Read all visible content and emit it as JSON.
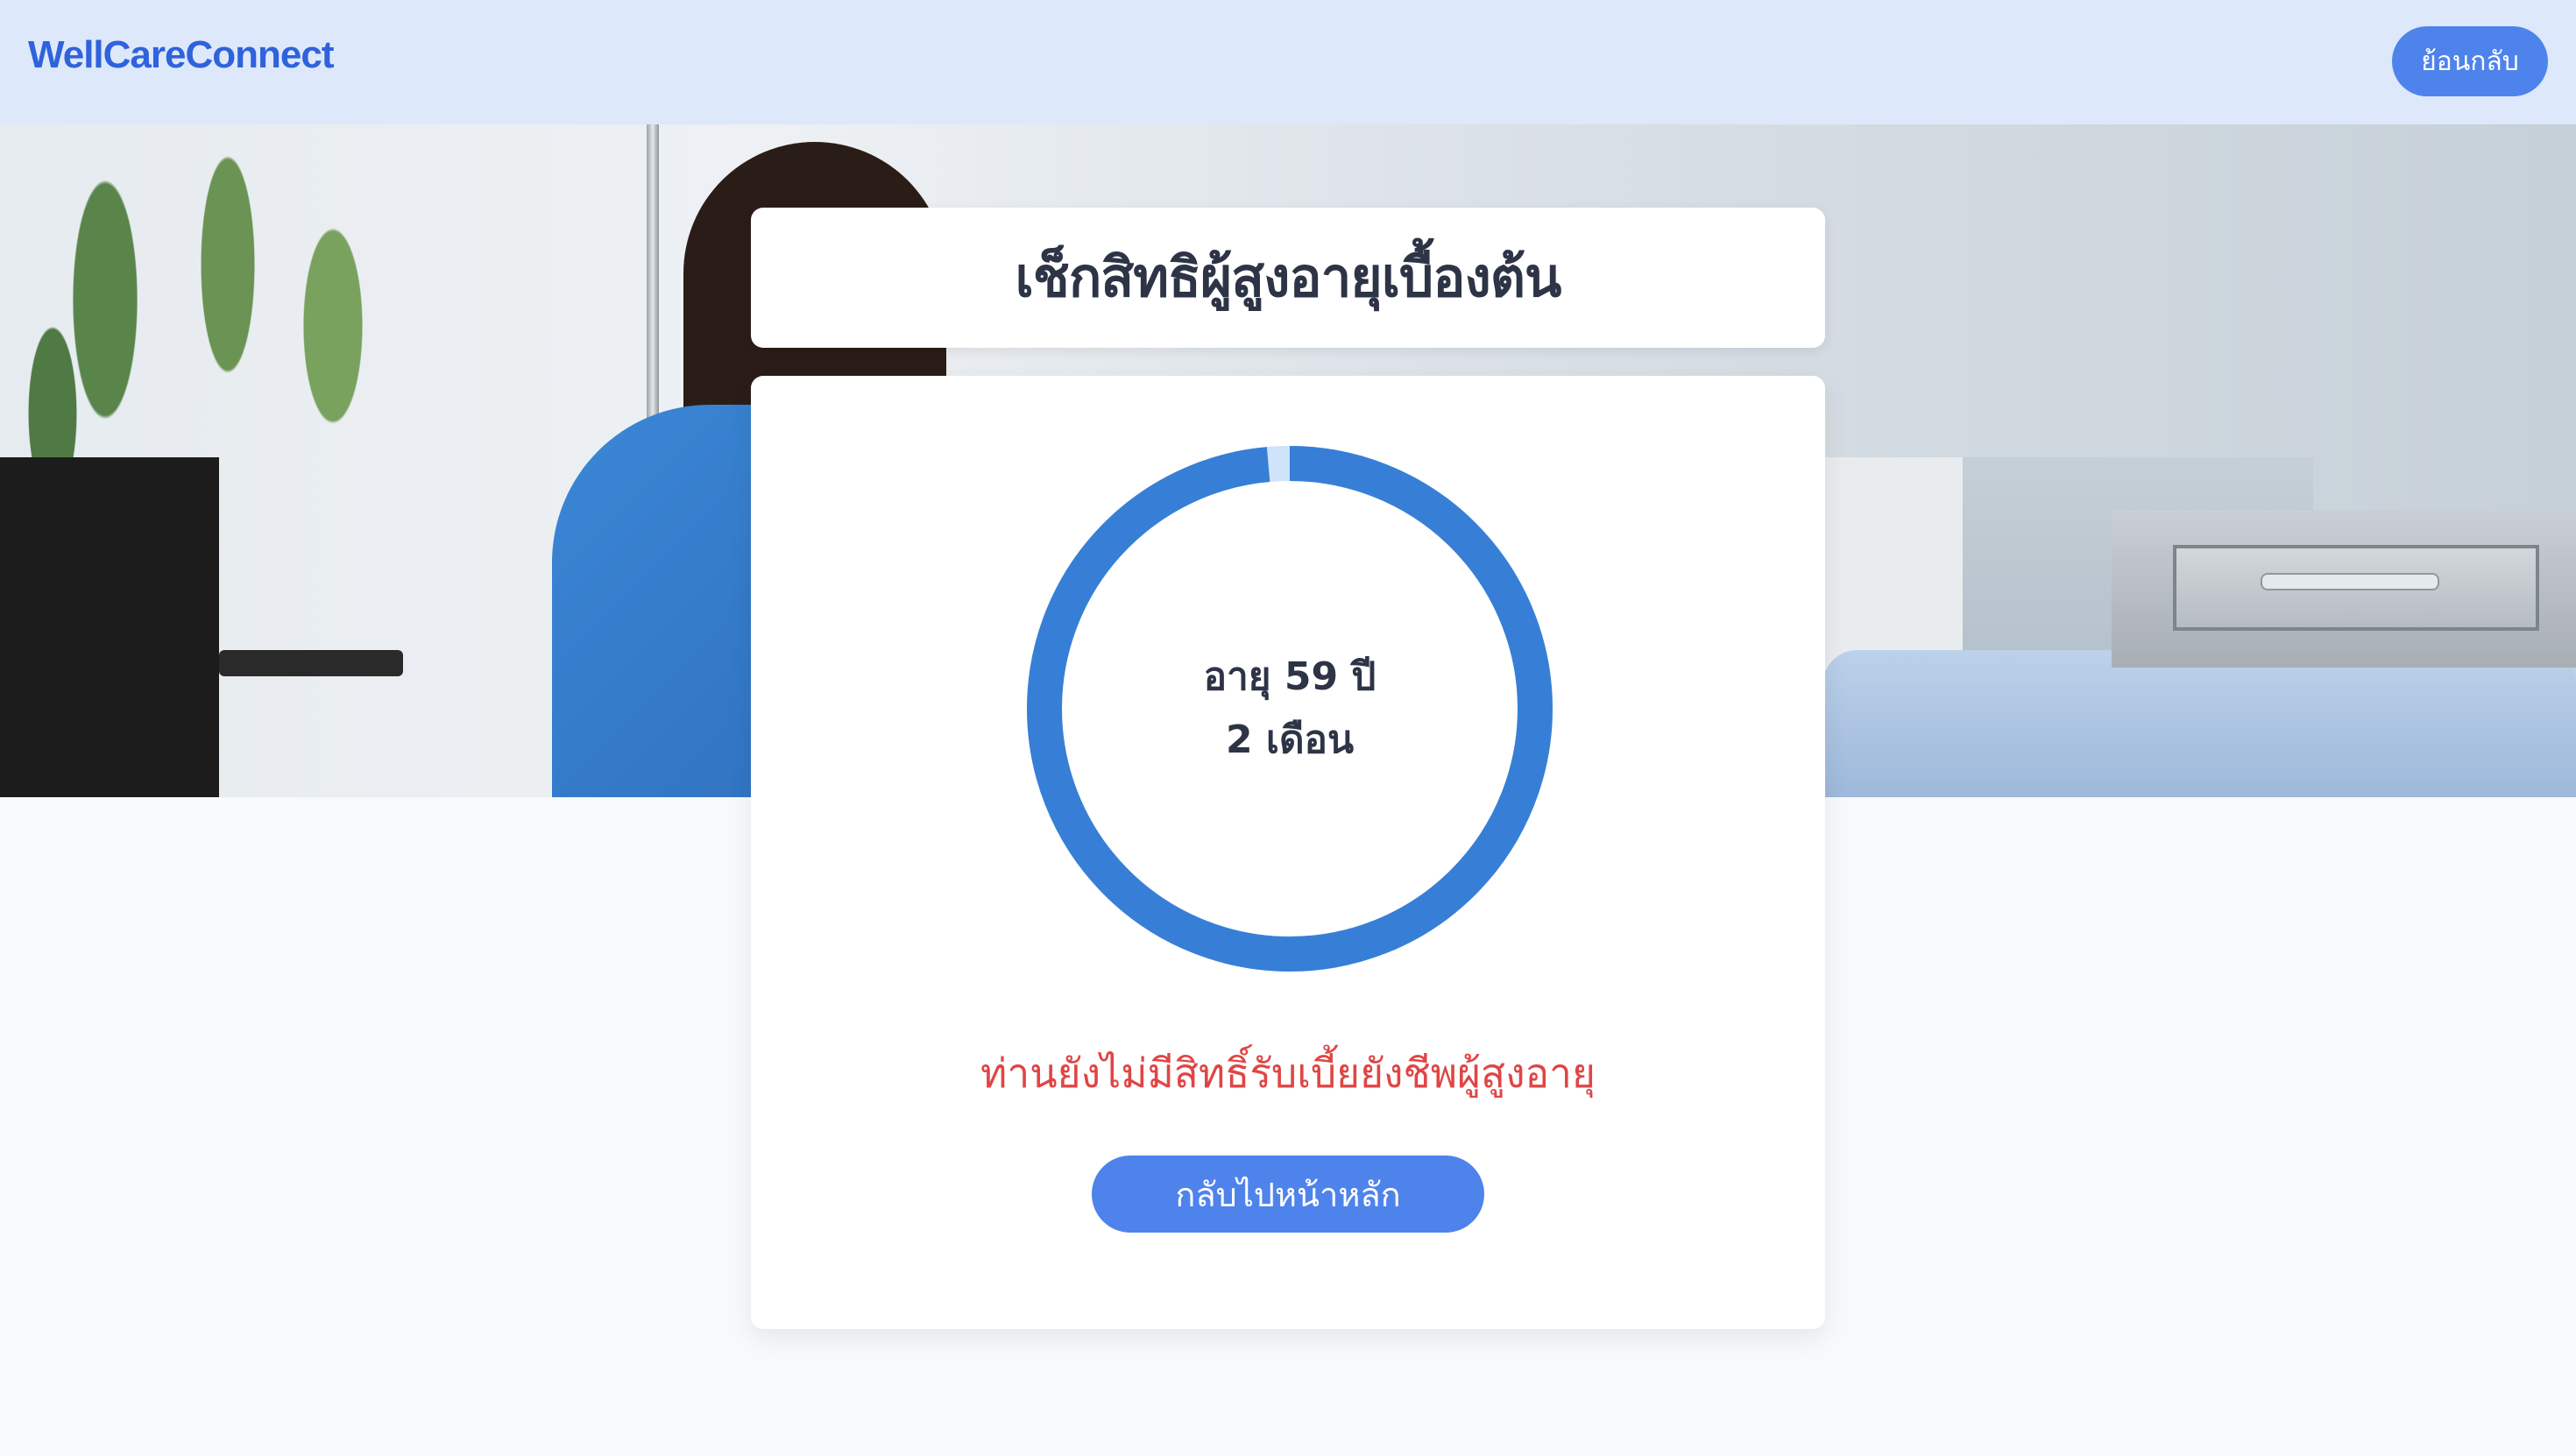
{
  "header": {
    "brand": "WellCareConnect",
    "back_label": "ย้อนกลับ"
  },
  "card": {
    "title": "เช็กสิทธิผู้สูงอายุเบื้องต้น",
    "age_line1": "อายุ 59 ปี",
    "age_line2": "2 เดือน",
    "progress_fraction": 0.986,
    "status_message": "ท่านยังไม่มีสิทธิ์รับเบี้ยยังชีพผู้สูงอายุ",
    "home_button_label": "กลับไปหน้าหลัก"
  },
  "colors": {
    "ring": "#377fd6",
    "ring_remaining": "#cfe3fa",
    "status": "#e04545",
    "button": "#4f83ec",
    "header_bg": "#dde8fa",
    "brand": "#2f62dc"
  }
}
